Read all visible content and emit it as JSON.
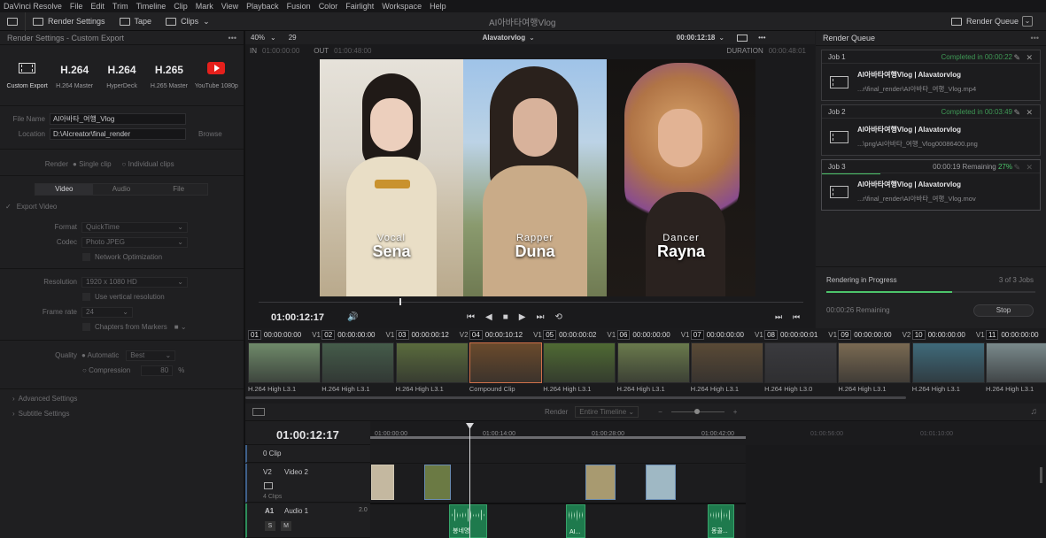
{
  "menu": [
    "DaVinci Resolve",
    "File",
    "Edit",
    "Trim",
    "Timeline",
    "Clip",
    "Mark",
    "View",
    "Playback",
    "Fusion",
    "Color",
    "Fairlight",
    "Workspace",
    "Help"
  ],
  "toolbar": {
    "render_settings": "Render Settings",
    "tape": "Tape",
    "clips": "Clips",
    "title": "AI아바타여행Vlog",
    "render_queue": "Render Queue"
  },
  "render_settings": {
    "header": "Render Settings - Custom Export",
    "presets": [
      {
        "big": "",
        "label": "Custom Export"
      },
      {
        "big": "H.264",
        "label": "H.264 Master"
      },
      {
        "big": "H.264",
        "label": "HyperDeck"
      },
      {
        "big": "H.265",
        "label": "H.265 Master"
      },
      {
        "big": "",
        "label": "YouTube 1080p"
      }
    ],
    "file_name_label": "File Name",
    "file_name": "AI아바타_여행_Vlog",
    "location_label": "Location",
    "location": "D:\\AIcreator\\final_render",
    "browse": "Browse",
    "render_label": "Render",
    "single_clip": "Single clip",
    "individual_clips": "Individual clips",
    "tabs": [
      "Video",
      "Audio",
      "File"
    ],
    "export_video": "Export Video",
    "format_label": "Format",
    "format": "QuickTime",
    "codec_label": "Codec",
    "codec": "Photo JPEG",
    "network_opt": "Network Optimization",
    "resolution_label": "Resolution",
    "resolution": "1920 x 1080 HD",
    "vertical_res": "Use vertical resolution",
    "frame_rate_label": "Frame rate",
    "frame_rate": "24",
    "chapters": "Chapters from Markers",
    "quality_label": "Quality",
    "automatic": "Automatic",
    "best": "Best",
    "compression": "Compression",
    "compression_val": "80",
    "pct": "%",
    "advanced": "Advanced Settings",
    "subtitle": "Subtitle Settings"
  },
  "viewer": {
    "zoom": "40%",
    "frames": "29",
    "name": "AIavatorvlog",
    "timecode": "00:00:12:18",
    "in_label": "IN",
    "in_tc": "01:00:00:00",
    "out_label": "OUT",
    "out_tc": "01:00:48:00",
    "duration_label": "DURATION",
    "duration_tc": "00:00:48:01",
    "current_tc": "01:00:12:17",
    "captions": [
      {
        "role": "Vocal",
        "name": "Sena"
      },
      {
        "role": "Rapper",
        "name": "Duna"
      },
      {
        "role": "Dancer",
        "name": "Rayna"
      }
    ]
  },
  "render_queue": {
    "header": "Render Queue",
    "jobs": [
      {
        "id": "Job 1",
        "status": "Completed in 00:00:22",
        "title": "AI아바타여행Vlog | AIavatorvlog",
        "path": "...r\\final_render\\AI아바타_여행_Vlog.mp4"
      },
      {
        "id": "Job 2",
        "status": "Completed in 00:03:49",
        "title": "AI아바타여행Vlog | AIavatorvlog",
        "path": "...\\png\\AI아바타_여행_Vlog00086400.png"
      },
      {
        "id": "Job 3",
        "status": "00:00:19 Remaining",
        "progress_text": "27%",
        "title": "AI아바타여행Vlog | AIavatorvlog",
        "path": "...r\\final_render\\AI아바타_여행_Vlog.mov"
      }
    ],
    "rendering": "Rendering in Progress",
    "count": "3 of 3 Jobs",
    "remaining": "00:00:26 Remaining",
    "stop": "Stop",
    "progress": 0.6
  },
  "clips": [
    {
      "num": "01",
      "tc": "00:00:00:00",
      "track": "V1",
      "label": "H.264 High L3.1",
      "color": "#6f8a6a"
    },
    {
      "num": "02",
      "tc": "00:00:00:00",
      "track": "V1",
      "label": "H.264 High L3.1",
      "color": "#455c4a"
    },
    {
      "num": "03",
      "tc": "00:00:00:12",
      "track": "V2",
      "label": "H.264 High L3.1",
      "color": "#5a6b3d"
    },
    {
      "num": "04",
      "tc": "00:00:10:12",
      "track": "V1",
      "label": "Compound Clip",
      "color": "#6a4a2c"
    },
    {
      "num": "05",
      "tc": "00:00:00:02",
      "track": "V1",
      "label": "H.264 High L3.1",
      "color": "#4f6a33"
    },
    {
      "num": "06",
      "tc": "00:00:00:00",
      "track": "V1",
      "label": "H.264 High L3.1",
      "color": "#6a7a4c"
    },
    {
      "num": "07",
      "tc": "00:00:00:00",
      "track": "V1",
      "label": "H.264 High L3.1",
      "color": "#5a4a36"
    },
    {
      "num": "08",
      "tc": "00:00:00:01",
      "track": "V1",
      "label": "H.264 High L3.0",
      "color": "#3a3a3e"
    },
    {
      "num": "09",
      "tc": "00:00:00:00",
      "track": "V2",
      "label": "H.264 High L3.1",
      "color": "#7a6a52"
    },
    {
      "num": "10",
      "tc": "00:00:00:00",
      "track": "V1",
      "label": "H.264 High L3.1",
      "color": "#3f6a7a"
    },
    {
      "num": "11",
      "tc": "00:00:00:00",
      "track": "V1",
      "label": "H.264 High L3.1",
      "color": "#7a8a8c"
    }
  ],
  "timeline": {
    "render_label": "Render",
    "render_mode": "Entire Timeline",
    "current_tc": "01:00:12:17",
    "ruler": [
      "01:00:00:00",
      "01:00:14:00",
      "01:00:28:00",
      "01:00:42:00",
      "01:00:56:00",
      "01:01:10:00"
    ],
    "tracks": {
      "clip_track": "0 Clip",
      "v2_id": "V2",
      "v2_name": "Video 2",
      "v2_count": "4 Clips",
      "a1_id": "A1",
      "a1_name": "Audio 1",
      "a1_level": "2.0",
      "s": "S",
      "m": "M"
    },
    "audio_clips": [
      "봉네명",
      "AI...",
      "몽콜..."
    ]
  }
}
